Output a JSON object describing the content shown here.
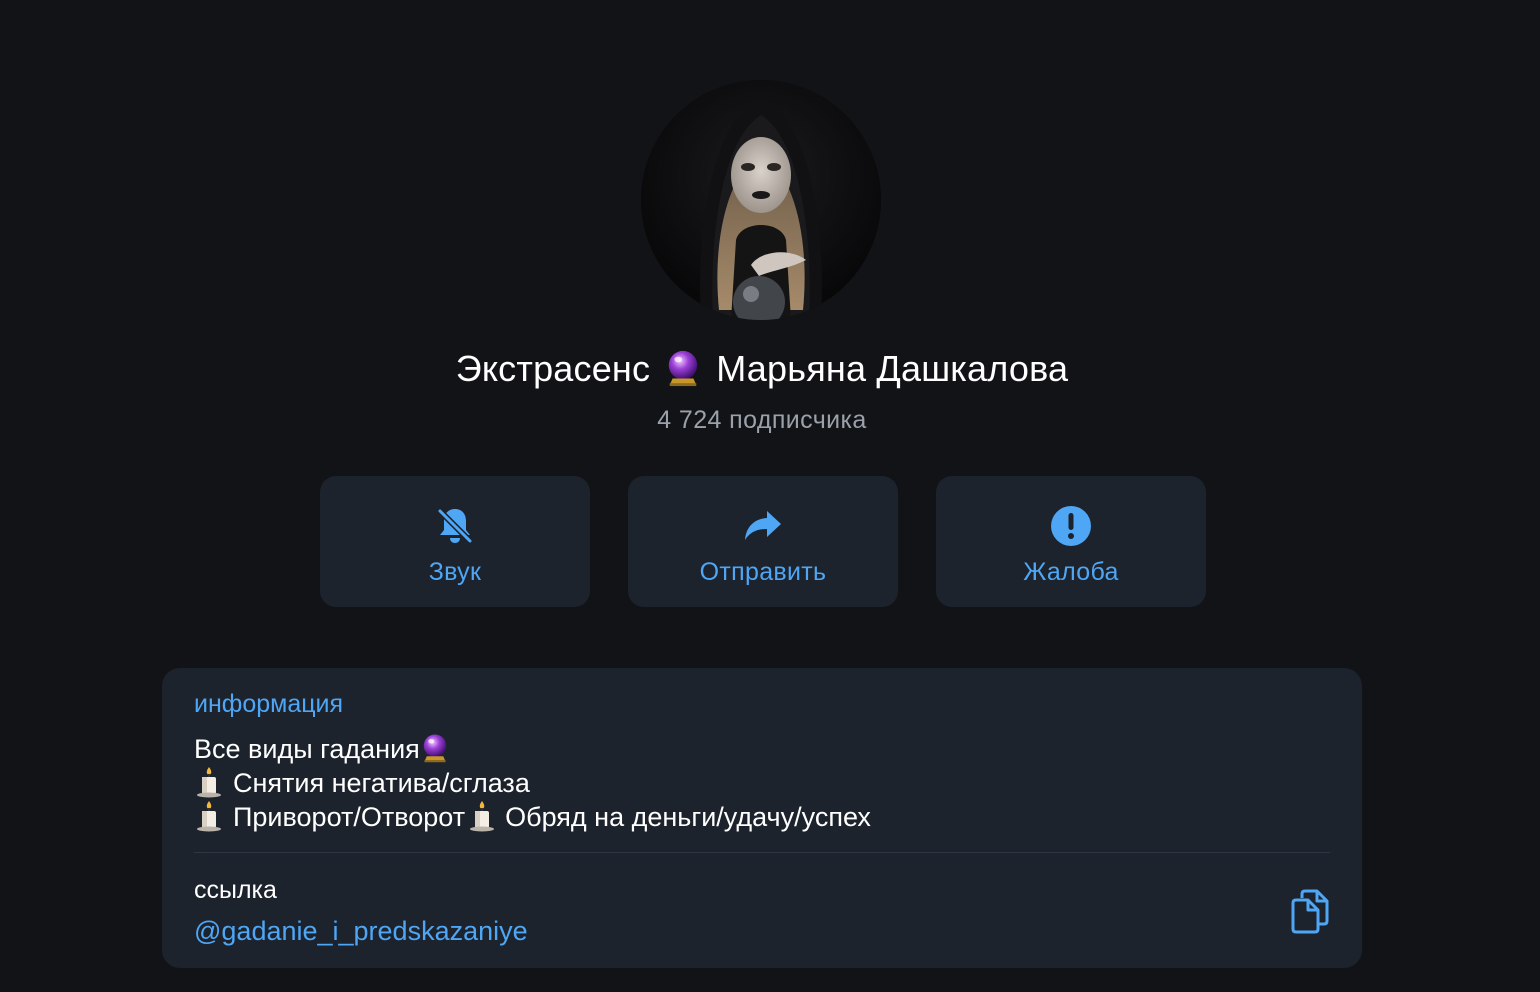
{
  "profile": {
    "name_part1": "Экстрасенс",
    "name_emoji": "crystal-ball",
    "name_part2": "Марьяна Дашкалова",
    "subscribers": "4 724 подписчика"
  },
  "actions": [
    {
      "label": "Звук",
      "icon": "bell-muted-icon"
    },
    {
      "label": "Отправить",
      "icon": "share-arrow-icon"
    },
    {
      "label": "Жалоба",
      "icon": "exclamation-circle-icon"
    }
  ],
  "info": {
    "header": "информация",
    "line1": "Все виды гадания",
    "line2": "Снятия негатива/сглаза",
    "line3_a": "Приворот/Отворот",
    "line3_b": "Обряд на деньги/удачу/успех"
  },
  "link": {
    "label": "ссылка",
    "value": "@gadanie_i_predskazaniye",
    "copy_icon": "copy-icon"
  },
  "colors": {
    "background": "#121316",
    "card": "#1c232d",
    "accent": "#4ea6f5",
    "secondary_text": "#9aa1ab"
  }
}
